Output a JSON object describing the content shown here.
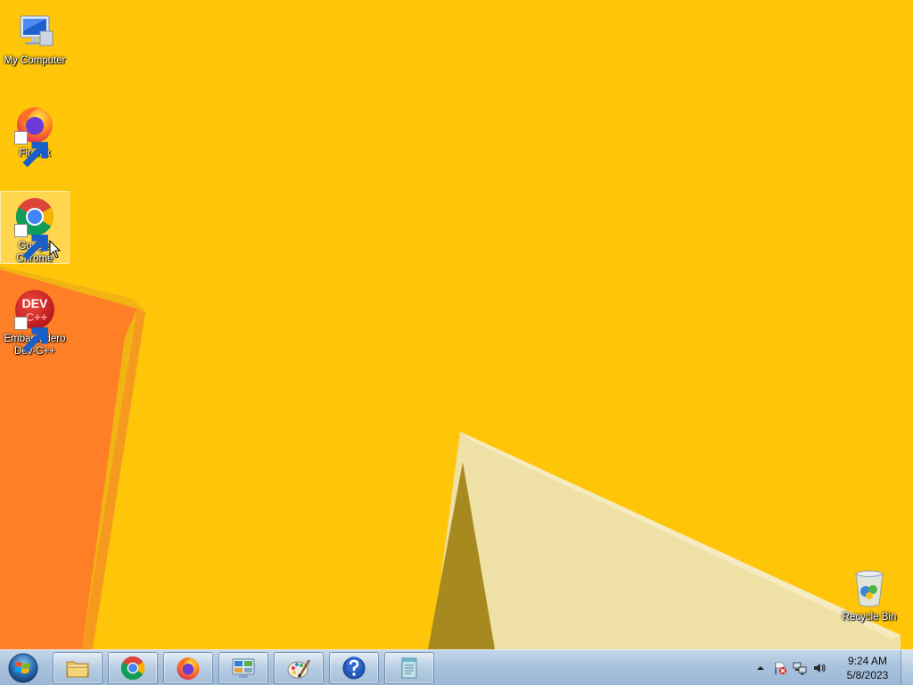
{
  "desktop": {
    "icons": [
      {
        "label": "My Computer",
        "icon": "computer-icon",
        "shortcut": false,
        "selected": false
      },
      {
        "label": "Firefox",
        "icon": "firefox-icon",
        "shortcut": true,
        "selected": false
      },
      {
        "label": "Google Chrome",
        "icon": "chrome-icon",
        "shortcut": true,
        "selected": true
      },
      {
        "label": "Embarcadero Dev-C++",
        "icon": "devcpp-icon",
        "shortcut": true,
        "selected": false
      },
      {
        "label": "Recycle Bin",
        "icon": "recycle-bin-icon",
        "shortcut": false,
        "selected": false
      }
    ],
    "devcpp_icon_text": {
      "line1": "DEV",
      "line2": "C++"
    }
  },
  "taskbar": {
    "pinned": [
      {
        "name": "explorer",
        "icon": "folder-icon"
      },
      {
        "name": "chrome",
        "icon": "chrome-icon"
      },
      {
        "name": "firefox",
        "icon": "firefox-icon"
      },
      {
        "name": "control-panel",
        "icon": "control-panel-icon"
      },
      {
        "name": "paint",
        "icon": "paint-icon"
      },
      {
        "name": "help",
        "icon": "help-icon"
      },
      {
        "name": "notepad",
        "icon": "notepad-icon"
      }
    ],
    "tray": {
      "icons": [
        "show-hidden-icons-arrow",
        "action-center-flag-icon",
        "network-icon",
        "volume-icon"
      ]
    },
    "clock": {
      "time": "9:24 AM",
      "date": "5/8/2023"
    }
  },
  "colors": {
    "wallpaper": "#ffc609",
    "wallpaper_orange": "#ff7f27",
    "wallpaper_cream": "#f0e2a6",
    "wallpaper_olive": "#a88a20",
    "taskbar": "#a9c3de"
  }
}
